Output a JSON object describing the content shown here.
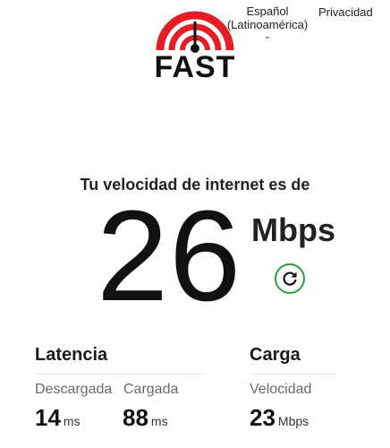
{
  "header": {
    "logo_text": "FAST",
    "language_line1": "Español",
    "language_line2": "(Latinoamérica)",
    "privacy_label": "Privacidad"
  },
  "result": {
    "headline": "Tu velocidad de internet es de",
    "speed_value": "26",
    "speed_unit": "Mbps"
  },
  "latency": {
    "title": "Latencia",
    "unloaded_label": "Descargada",
    "loaded_label": "Cargada",
    "unloaded_value": "14",
    "unloaded_unit": "ms",
    "loaded_value": "88",
    "loaded_unit": "ms"
  },
  "upload": {
    "title": "Carga",
    "speed_label": "Velocidad",
    "speed_value": "23",
    "speed_unit": "Mbps"
  },
  "colors": {
    "brand_red": "#e31e26",
    "reload_green": "#27a040"
  }
}
